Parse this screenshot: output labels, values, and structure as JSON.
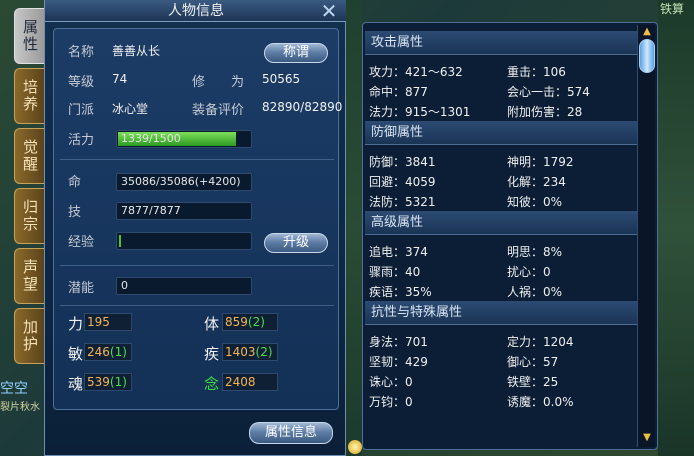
{
  "side_tabs": [
    {
      "label": "属性",
      "active": true
    },
    {
      "label": "培养",
      "active": false
    },
    {
      "label": "觉醒",
      "active": false
    },
    {
      "label": "归宗",
      "active": false
    },
    {
      "label": "声望",
      "active": false
    },
    {
      "label": "加护",
      "active": false
    }
  ],
  "side_text": [
    "空空",
    "裂片秋水"
  ],
  "right_edge_text": "铁算",
  "panel": {
    "title": "人物信息",
    "close_icon": "close-icon",
    "name_label": "名称",
    "name_value": "善善从长",
    "title_button": "称谓",
    "level_label": "等级",
    "level_value": "74",
    "cultivation_label": "修　　为",
    "cultivation_value": "50565",
    "faction_label": "门派",
    "faction_value": "冰心堂",
    "equip_label": "装备评价",
    "equip_value": "82890/82890",
    "vitality_label": "活力",
    "vitality_value": "1339/1500",
    "vitality_fraction": 0.893,
    "hp_label": "命",
    "hp_value": "35086/35086(+4200)",
    "skill_label": "技",
    "skill_value": "7877/7877",
    "exp_label": "经验",
    "exp_value": "",
    "upgrade_button": "升级",
    "potential_label": "潜能",
    "potential_value": "0",
    "stats": [
      {
        "label": "力",
        "base": "195",
        "bonus": "",
        "highlight": false
      },
      {
        "label": "体",
        "base": "859",
        "bonus": "(2)",
        "highlight": false
      },
      {
        "label": "敏",
        "base": "246",
        "bonus": "(1)",
        "highlight": false
      },
      {
        "label": "疾",
        "base": "1403",
        "bonus": "(2)",
        "highlight": false
      },
      {
        "label": "魂",
        "base": "539",
        "bonus": "(1)",
        "highlight": false
      },
      {
        "label": "念",
        "base": "2408",
        "bonus": "",
        "highlight": true
      }
    ],
    "attr_info_button": "属性信息"
  },
  "attributes": {
    "attack_header": "攻击属性",
    "attack": [
      [
        "攻力：421～632",
        "重击：106"
      ],
      [
        "命中：877",
        "会心一击：574"
      ],
      [
        "法力：915～1301",
        "附加伤害：28"
      ]
    ],
    "defense_header": "防御属性",
    "defense": [
      [
        "防御：3841",
        "神明：1792"
      ],
      [
        "回避：4059",
        "化解：234"
      ],
      [
        "法防：5321",
        "知彼：0%"
      ]
    ],
    "advanced_header": "高级属性",
    "advanced": [
      [
        "追电：374",
        "明思：8%"
      ],
      [
        "骤雨：40",
        "扰心：0"
      ],
      [
        "疾语：35%",
        "人祸：0%"
      ]
    ],
    "resist_header": "抗性与特殊属性",
    "resist": [
      [
        "身法：701",
        "定力：1204"
      ],
      [
        "坚韧：429",
        "御心：57"
      ],
      [
        "诛心：0",
        "铁壁：25"
      ],
      [
        "万钧：0",
        "诱魔：0.0%"
      ]
    ]
  },
  "colors": {
    "stat_base": "#f3b45a",
    "stat_bonus": "#46e04a",
    "highlight_label": "#3fe03f",
    "vitality_bar": "#4cc23a"
  }
}
